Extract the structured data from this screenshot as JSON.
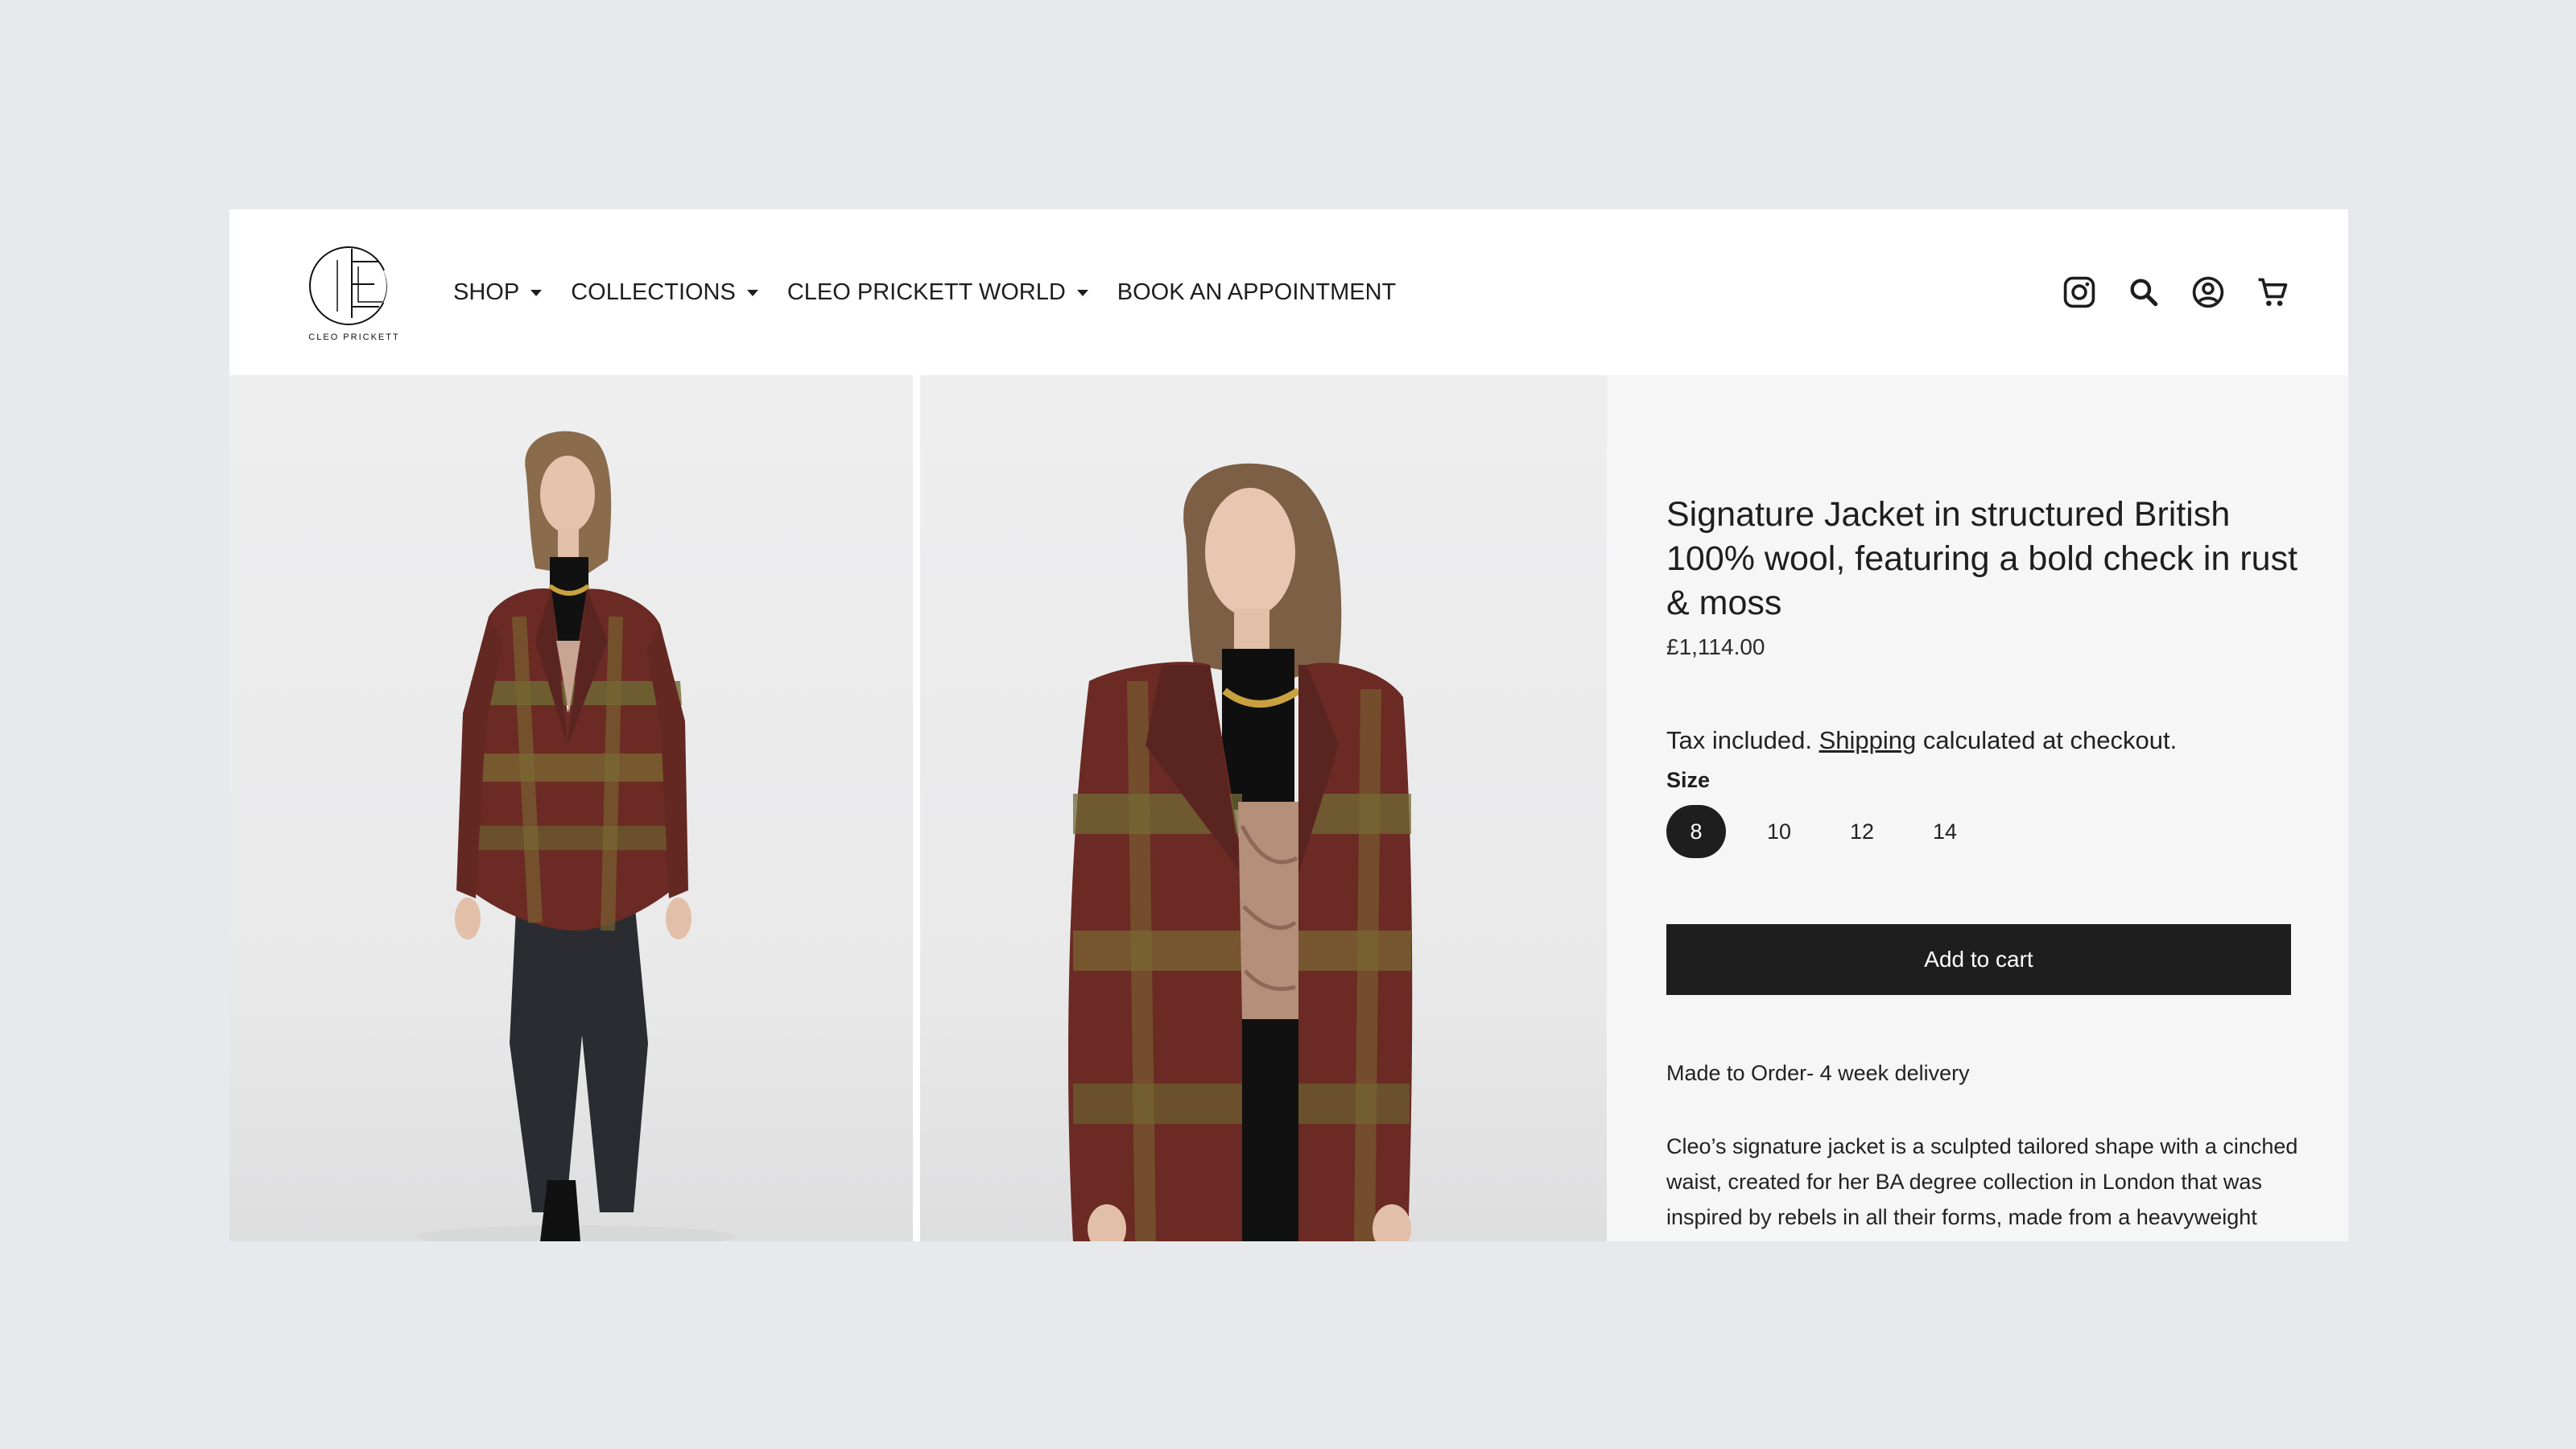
{
  "header": {
    "logo_text": "CLEO PRICKETT",
    "nav": [
      {
        "label": "SHOP",
        "has_caret": true
      },
      {
        "label": "COLLECTIONS",
        "has_caret": true
      },
      {
        "label": "CLEO PRICKETT WORLD",
        "has_caret": true
      },
      {
        "label": "BOOK AN APPOINTMENT",
        "has_caret": false
      }
    ],
    "icons": [
      "instagram-icon",
      "search-icon",
      "account-icon",
      "cart-icon"
    ]
  },
  "gallery": {
    "images": [
      "product-image-full-length",
      "product-image-close-up"
    ]
  },
  "product": {
    "title": "Signature Jacket in structured British 100% wool, featuring a bold check in rust & moss",
    "price": "£1,114.00",
    "tax_prefix": "Tax included.",
    "tax_link": "Shipping",
    "tax_suffix": "calculated at checkout.",
    "size_label": "Size",
    "sizes": [
      "8",
      "10",
      "12",
      "14"
    ],
    "selected_size": "8",
    "add_to_cart": "Add to cart",
    "delivery": "Made to Order- 4 week delivery",
    "description": "Cleo’s signature jacket is a sculpted tailored shape with a cinched waist, created for her BA degree collection in London that was inspired by rebels in all their forms, made from a heavyweight"
  },
  "colors": {
    "page_bg": "#e7e9ed",
    "text": "#1e1e1e",
    "button_bg": "#1e1e1e",
    "info_bg": "#f6f6f6"
  }
}
